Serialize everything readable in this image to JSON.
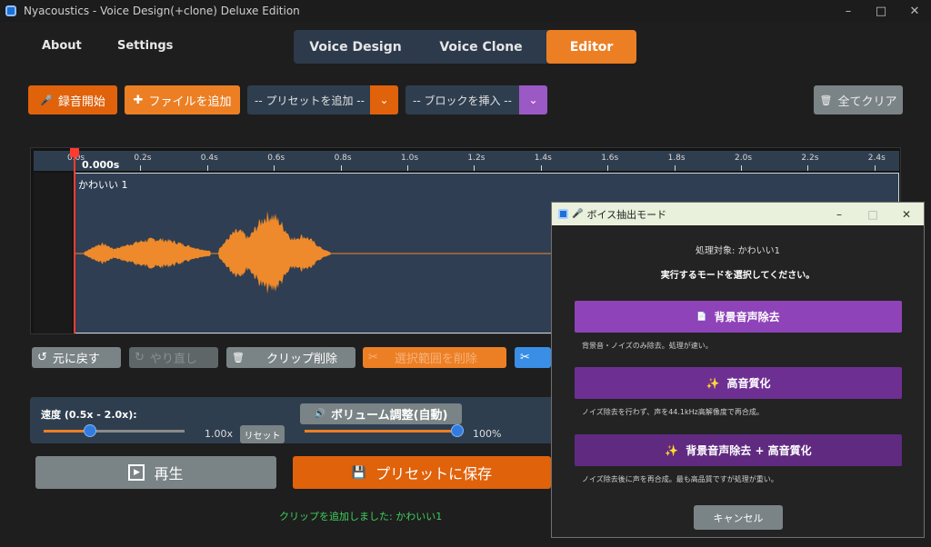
{
  "window": {
    "title": "Nyacoustics - Voice Design(+clone) Deluxe Edition"
  },
  "nav": {
    "about": "About",
    "settings": "Settings"
  },
  "tabs": [
    {
      "label": "Voice Design"
    },
    {
      "label": "Voice Clone"
    },
    {
      "label": "Editor"
    }
  ],
  "toolbar": {
    "record": "録音開始",
    "add_file": "ファイルを追加",
    "preset_placeholder": "-- プリセットを追加 --",
    "block_placeholder": "-- ブロックを挿入 --",
    "clear_all": "全てクリア"
  },
  "timeline": {
    "ticks": [
      "0.0s",
      "0.2s",
      "0.4s",
      "0.6s",
      "0.8s",
      "1.0s",
      "1.2s",
      "1.4s",
      "1.6s",
      "1.8s",
      "2.0s",
      "2.2s",
      "2.4s"
    ],
    "current_time": "0.000s",
    "clip_name": "かわいい 1"
  },
  "edit": {
    "undo": "元に戻す",
    "redo": "やり直し",
    "delete_clip": "クリップ削除",
    "delete_selection": "選択範囲を削除"
  },
  "controls": {
    "speed_label": "速度 (0.5x - 2.0x):",
    "speed_value": "1.00x",
    "reset": "リセット",
    "speed_level": 0.33,
    "volume_label": "ボリューム調整(自動)",
    "volume_value": "100%",
    "volume_level": 1.0
  },
  "actions": {
    "play": "再生",
    "save_preset": "プリセットに保存"
  },
  "status": "クリップを追加しました: かわいい1",
  "dialog": {
    "title": "ボイス抽出モード",
    "target": "処理対象: かわいい1",
    "prompt": "実行するモードを選択してください。",
    "modes": [
      {
        "label": "背景音声除去",
        "desc": "背景音・ノイズのみ除去。処理が速い。",
        "color": "#8e44b8"
      },
      {
        "label": "高音質化",
        "desc": "ノイズ除去を行わず、声を44.1kHz高解像度で再合成。",
        "color": "#6e2f93"
      },
      {
        "label": "背景音声除去 + 高音質化",
        "desc": "ノイズ除去後に声を再合成。最も高品質ですが処理が重い。",
        "color": "#5f2a80"
      }
    ],
    "cancel": "キャンセル"
  },
  "colors": {
    "accent": "#ec7f24",
    "record": "#e0620b",
    "panel": "#2f3e4f",
    "waveform": "#ee8a2b",
    "playhead": "#ff3b30"
  }
}
